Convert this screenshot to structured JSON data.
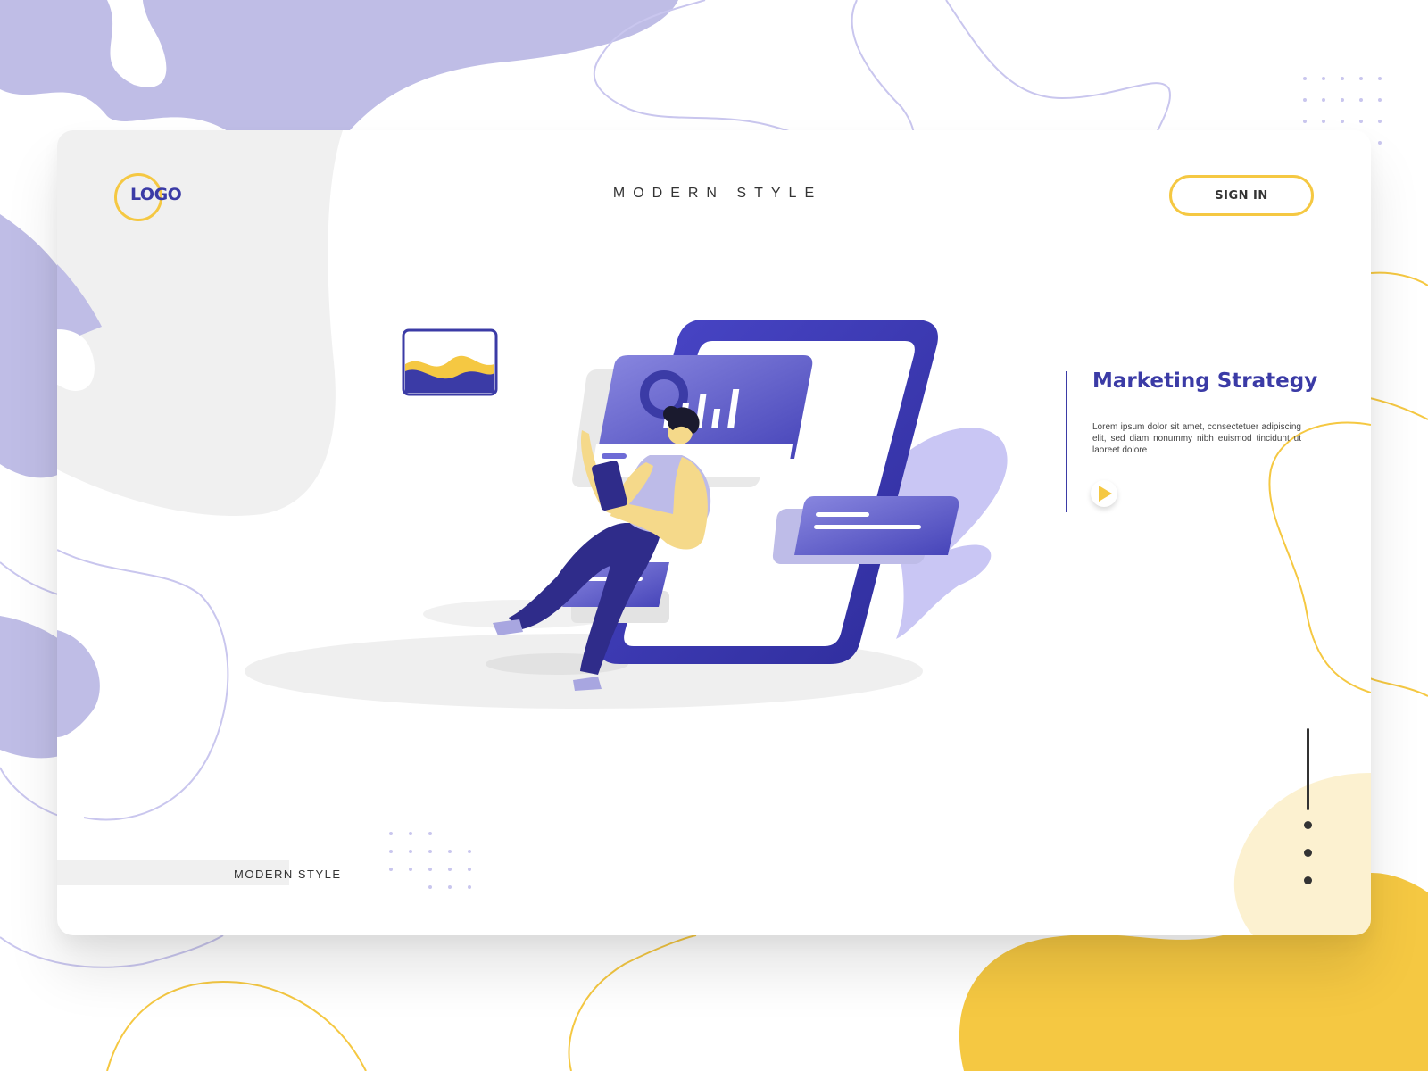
{
  "header": {
    "logo_text": "LOGO",
    "nav_title": "MODERN STYLE",
    "signin_label": "SIGN IN"
  },
  "hero": {
    "heading": "Marketing Strategy",
    "body": "Lorem ipsum dolor sit amet, consectetuer adipiscing elit, sed diam nonummy nibh euismod tincidunt ut laoreet dolore",
    "play_icon": "play-icon"
  },
  "footer": {
    "label": "MODERN STYLE"
  },
  "pagination": {
    "dot_count": 3
  },
  "colors": {
    "accent_purple": "#3b3ba6",
    "accent_yellow": "#f5c842",
    "lavender": "#bfbde6",
    "light_gray": "#f0f0f0"
  }
}
